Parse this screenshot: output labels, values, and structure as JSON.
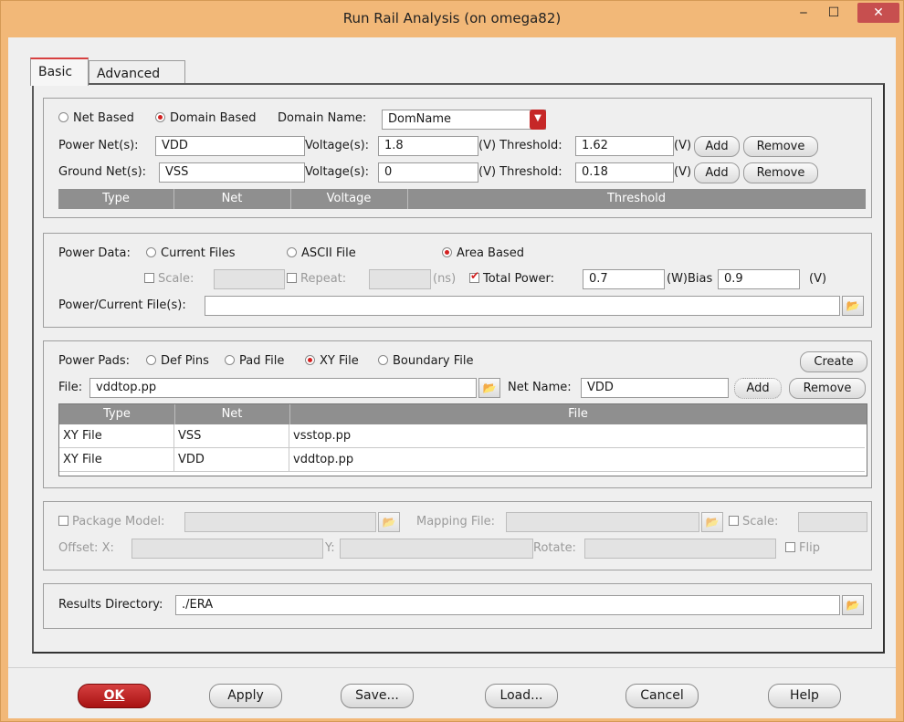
{
  "window": {
    "title": "Run Rail Analysis (on omega82)",
    "minimize": "‒",
    "maximize": "☐",
    "close": "✕"
  },
  "tabs": [
    {
      "label": "Basic"
    },
    {
      "label": "Advanced"
    }
  ],
  "domain": {
    "net_based": "Net Based",
    "domain_based": "Domain Based",
    "domain_name_label": "Domain Name:",
    "domain_name_value": "DomName",
    "power_net_label": "Power Net(s):",
    "power_net": "VDD",
    "voltage_label": "Voltage(s):",
    "power_voltage": "1.8",
    "threshold_label": "(V) Threshold:",
    "power_threshold": "1.62",
    "unit_v": "(V)",
    "add": "Add",
    "remove": "Remove",
    "ground_net_label": "Ground Net(s):",
    "ground_net": "VSS",
    "ground_voltage": "0",
    "ground_threshold": "0.18",
    "columns": [
      "Type",
      "Net",
      "Voltage",
      "Threshold"
    ]
  },
  "power_data": {
    "label": "Power Data:",
    "current_files": "Current Files",
    "ascii_file": "ASCII File",
    "area_based": "Area Based",
    "scale_label": "Scale:",
    "repeat_label": "Repeat:",
    "ns_unit": "(ns)",
    "total_power_label": "Total Power:",
    "total_power": "0.7",
    "w_bias_label": "(W)Bias",
    "bias": "0.9",
    "v_unit": "(V)",
    "file_label": "Power/Current File(s):",
    "file_value": ""
  },
  "power_pads": {
    "label": "Power Pads:",
    "def_pins": "Def Pins",
    "pad_file": "Pad File",
    "xy_file": "XY File",
    "boundary_file": "Boundary File",
    "create": "Create",
    "file_label": "File:",
    "file_value": "vddtop.pp",
    "net_name_label": "Net Name:",
    "net_name": "VDD",
    "add": "Add",
    "remove": "Remove",
    "columns": [
      "Type",
      "Net",
      "File"
    ],
    "rows": [
      {
        "type": "XY File",
        "net": "VSS",
        "file": "vsstop.pp"
      },
      {
        "type": "XY File",
        "net": "VDD",
        "file": "vddtop.pp"
      }
    ]
  },
  "package": {
    "package_model_label": "Package Model:",
    "mapping_file_label": "Mapping File:",
    "scale_label": "Scale:",
    "offset_x_label": "Offset:  X:",
    "y_label": "Y:",
    "rotate_label": "Rotate:",
    "flip_label": "Flip"
  },
  "results": {
    "label": "Results Directory:",
    "value": "./ERA"
  },
  "buttons": {
    "ok": "OK",
    "apply": "Apply",
    "save": "Save...",
    "load": "Load...",
    "cancel": "Cancel",
    "help": "Help"
  }
}
